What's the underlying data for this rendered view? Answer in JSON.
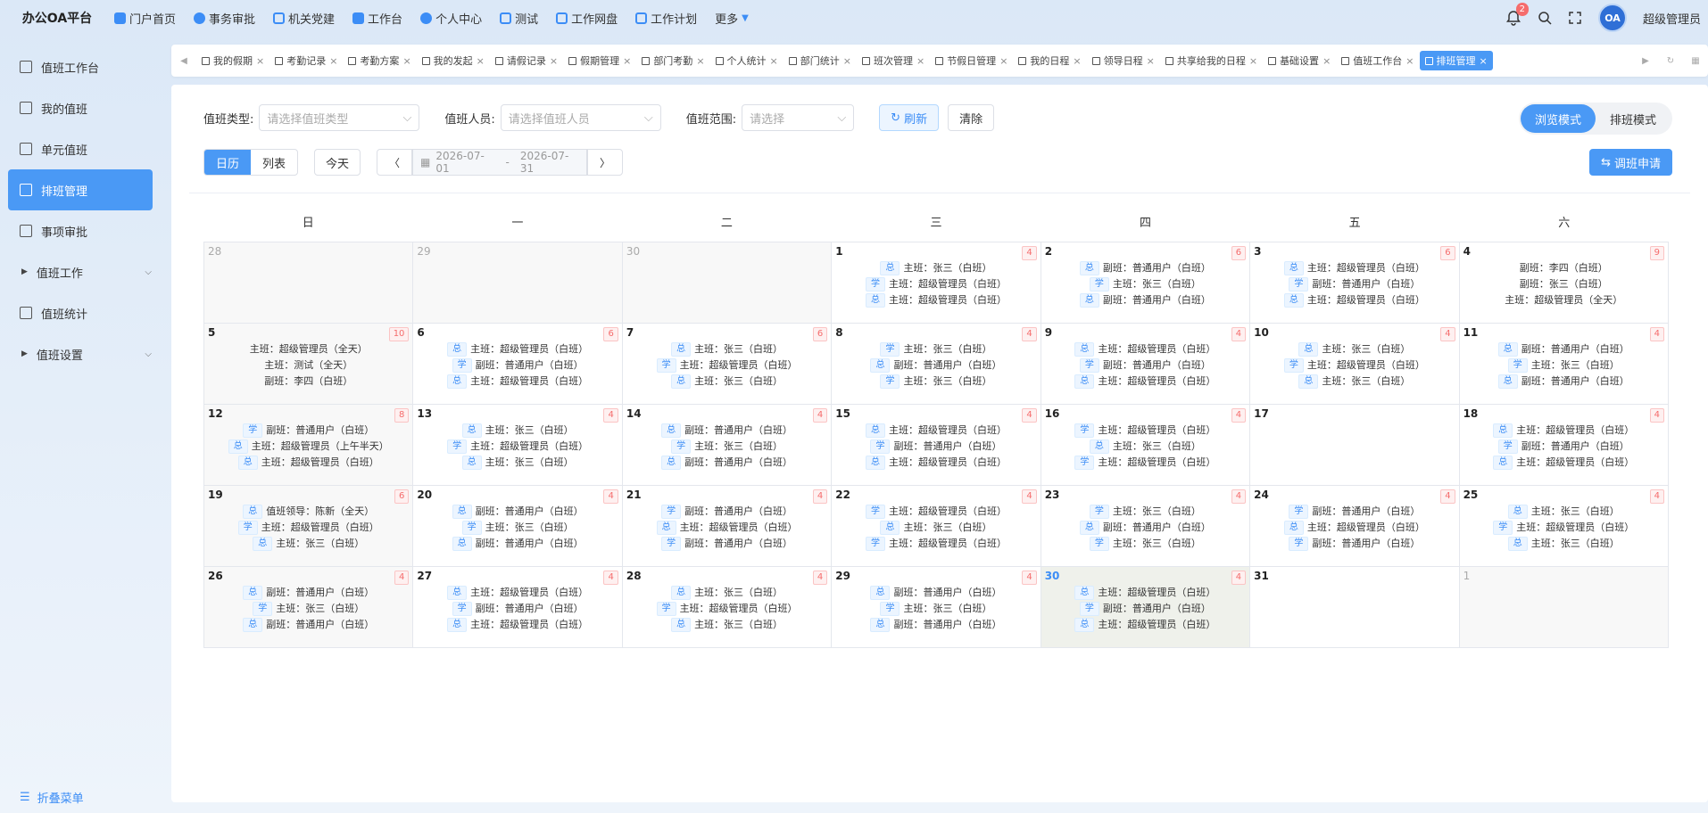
{
  "brand": "办公OA平台",
  "topnav": [
    "门户首页",
    "事务审批",
    "机关党建",
    "工作台",
    "个人中心",
    "测试",
    "工作网盘",
    "工作计划",
    "更多"
  ],
  "notif_count": "2",
  "avatar_text": "OA",
  "user_name": "超级管理员",
  "sidebar": [
    "值班工作台",
    "我的值班",
    "单元值班",
    "排班管理",
    "事项审批",
    "值班工作",
    "值班统计",
    "值班设置"
  ],
  "collapse_label": "折叠菜单",
  "tabs": [
    "我的假期",
    "考勤记录",
    "考勤方案",
    "我的发起",
    "请假记录",
    "假期管理",
    "部门考勤",
    "个人统计",
    "部门统计",
    "班次管理",
    "节假日管理",
    "我的日程",
    "领导日程",
    "共享给我的日程",
    "基础设置",
    "值班工作台",
    "排班管理"
  ],
  "filters": {
    "type_label": "值班类型:",
    "type_placeholder": "请选择值班类型",
    "person_label": "值班人员:",
    "person_placeholder": "请选择值班人员",
    "scope_label": "值班范围:",
    "scope_placeholder": "请选择",
    "refresh": "刷新",
    "clear": "清除"
  },
  "modes": [
    "浏览模式",
    "排班模式"
  ],
  "view_tabs": [
    "日历",
    "列表"
  ],
  "today_btn": "今天",
  "date_start": "2026-07-01",
  "date_sep": "-",
  "date_end": "2026-07-31",
  "apply_btn": "调班申请",
  "weekdays": [
    "日",
    "一",
    "二",
    "三",
    "四",
    "五",
    "六"
  ],
  "days": [
    {
      "d": "28",
      "other": true,
      "cnt": "",
      "ev": []
    },
    {
      "d": "29",
      "other": true,
      "cnt": "",
      "ev": []
    },
    {
      "d": "30",
      "other": true,
      "cnt": "",
      "ev": []
    },
    {
      "d": "1",
      "cnt": "4",
      "ev": [
        [
          "总",
          "主班：张三（白班）"
        ],
        [
          "学",
          "主班：超级管理员（白班）"
        ],
        [
          "总",
          "主班：超级管理员（白班）"
        ]
      ]
    },
    {
      "d": "2",
      "cnt": "6",
      "ev": [
        [
          "总",
          "副班：普通用户（白班）"
        ],
        [
          "学",
          "主班：张三（白班）"
        ],
        [
          "总",
          "副班：普通用户（白班）"
        ]
      ]
    },
    {
      "d": "3",
      "cnt": "6",
      "ev": [
        [
          "总",
          "主班：超级管理员（白班）"
        ],
        [
          "学",
          "副班：普通用户（白班）"
        ],
        [
          "总",
          "主班：超级管理员（白班）"
        ]
      ]
    },
    {
      "d": "4",
      "cnt": "9",
      "ev": [
        [
          "",
          "副班：李四（白班）"
        ],
        [
          "",
          "副班：张三（白班）"
        ],
        [
          "",
          "主班：超级管理员（全天）"
        ]
      ]
    },
    {
      "d": "5",
      "cnt": "10",
      "ev": [
        [
          "",
          "主班：超级管理员（全天）"
        ],
        [
          "",
          "主班：测试（全天）"
        ],
        [
          "",
          "副班：李四（白班）"
        ]
      ]
    },
    {
      "d": "6",
      "cnt": "6",
      "ev": [
        [
          "总",
          "主班：超级管理员（白班）"
        ],
        [
          "学",
          "副班：普通用户（白班）"
        ],
        [
          "总",
          "主班：超级管理员（白班）"
        ]
      ]
    },
    {
      "d": "7",
      "cnt": "6",
      "ev": [
        [
          "总",
          "主班：张三（白班）"
        ],
        [
          "学",
          "主班：超级管理员（白班）"
        ],
        [
          "总",
          "主班：张三（白班）"
        ]
      ]
    },
    {
      "d": "8",
      "cnt": "4",
      "ev": [
        [
          "学",
          "主班：张三（白班）"
        ],
        [
          "总",
          "副班：普通用户（白班）"
        ],
        [
          "学",
          "主班：张三（白班）"
        ]
      ]
    },
    {
      "d": "9",
      "cnt": "4",
      "ev": [
        [
          "总",
          "主班：超级管理员（白班）"
        ],
        [
          "学",
          "副班：普通用户（白班）"
        ],
        [
          "总",
          "主班：超级管理员（白班）"
        ]
      ]
    },
    {
      "d": "10",
      "cnt": "4",
      "ev": [
        [
          "总",
          "主班：张三（白班）"
        ],
        [
          "学",
          "主班：超级管理员（白班）"
        ],
        [
          "总",
          "主班：张三（白班）"
        ]
      ]
    },
    {
      "d": "11",
      "cnt": "4",
      "ev": [
        [
          "总",
          "副班：普通用户（白班）"
        ],
        [
          "学",
          "主班：张三（白班）"
        ],
        [
          "总",
          "副班：普通用户（白班）"
        ]
      ]
    },
    {
      "d": "12",
      "cnt": "8",
      "ev": [
        [
          "学",
          "副班：普通用户（白班）"
        ],
        [
          "总",
          "主班：超级管理员（上午半天）"
        ],
        [
          "总",
          "主班：超级管理员（白班）"
        ]
      ]
    },
    {
      "d": "13",
      "cnt": "4",
      "ev": [
        [
          "总",
          "主班：张三（白班）"
        ],
        [
          "学",
          "主班：超级管理员（白班）"
        ],
        [
          "总",
          "主班：张三（白班）"
        ]
      ]
    },
    {
      "d": "14",
      "cnt": "4",
      "ev": [
        [
          "总",
          "副班：普通用户（白班）"
        ],
        [
          "学",
          "主班：张三（白班）"
        ],
        [
          "总",
          "副班：普通用户（白班）"
        ]
      ]
    },
    {
      "d": "15",
      "cnt": "4",
      "ev": [
        [
          "总",
          "主班：超级管理员（白班）"
        ],
        [
          "学",
          "副班：普通用户（白班）"
        ],
        [
          "总",
          "主班：超级管理员（白班）"
        ]
      ]
    },
    {
      "d": "16",
      "cnt": "4",
      "ev": [
        [
          "学",
          "主班：超级管理员（白班）"
        ],
        [
          "总",
          "主班：张三（白班）"
        ],
        [
          "学",
          "主班：超级管理员（白班）"
        ]
      ]
    },
    {
      "d": "17",
      "cnt": "",
      "ev": []
    },
    {
      "d": "18",
      "cnt": "4",
      "ev": [
        [
          "总",
          "主班：超级管理员（白班）"
        ],
        [
          "学",
          "副班：普通用户（白班）"
        ],
        [
          "总",
          "主班：超级管理员（白班）"
        ]
      ]
    },
    {
      "d": "19",
      "cnt": "6",
      "ev": [
        [
          "总",
          "值班领导：陈新（全天）"
        ],
        [
          "学",
          "主班：超级管理员（白班）"
        ],
        [
          "总",
          "主班：张三（白班）"
        ]
      ]
    },
    {
      "d": "20",
      "cnt": "4",
      "ev": [
        [
          "总",
          "副班：普通用户（白班）"
        ],
        [
          "学",
          "主班：张三（白班）"
        ],
        [
          "总",
          "副班：普通用户（白班）"
        ]
      ]
    },
    {
      "d": "21",
      "cnt": "4",
      "ev": [
        [
          "学",
          "副班：普通用户（白班）"
        ],
        [
          "总",
          "主班：超级管理员（白班）"
        ],
        [
          "学",
          "副班：普通用户（白班）"
        ]
      ]
    },
    {
      "d": "22",
      "cnt": "4",
      "ev": [
        [
          "学",
          "主班：超级管理员（白班）"
        ],
        [
          "总",
          "主班：张三（白班）"
        ],
        [
          "学",
          "主班：超级管理员（白班）"
        ]
      ]
    },
    {
      "d": "23",
      "cnt": "4",
      "ev": [
        [
          "学",
          "主班：张三（白班）"
        ],
        [
          "总",
          "副班：普通用户（白班）"
        ],
        [
          "学",
          "主班：张三（白班）"
        ]
      ]
    },
    {
      "d": "24",
      "cnt": "4",
      "ev": [
        [
          "学",
          "副班：普通用户（白班）"
        ],
        [
          "总",
          "主班：超级管理员（白班）"
        ],
        [
          "学",
          "副班：普通用户（白班）"
        ]
      ]
    },
    {
      "d": "25",
      "cnt": "4",
      "ev": [
        [
          "总",
          "主班：张三（白班）"
        ],
        [
          "学",
          "主班：超级管理员（白班）"
        ],
        [
          "总",
          "主班：张三（白班）"
        ]
      ]
    },
    {
      "d": "26",
      "cnt": "4",
      "ev": [
        [
          "总",
          "副班：普通用户（白班）"
        ],
        [
          "学",
          "主班：张三（白班）"
        ],
        [
          "总",
          "副班：普通用户（白班）"
        ]
      ]
    },
    {
      "d": "27",
      "cnt": "4",
      "ev": [
        [
          "总",
          "主班：超级管理员（白班）"
        ],
        [
          "学",
          "副班：普通用户（白班）"
        ],
        [
          "总",
          "主班：超级管理员（白班）"
        ]
      ]
    },
    {
      "d": "28",
      "cnt": "4",
      "ev": [
        [
          "总",
          "主班：张三（白班）"
        ],
        [
          "学",
          "主班：超级管理员（白班）"
        ],
        [
          "总",
          "主班：张三（白班）"
        ]
      ]
    },
    {
      "d": "29",
      "cnt": "4",
      "ev": [
        [
          "总",
          "副班：普通用户（白班）"
        ],
        [
          "学",
          "主班：张三（白班）"
        ],
        [
          "总",
          "副班：普通用户（白班）"
        ]
      ]
    },
    {
      "d": "30",
      "today": true,
      "cnt": "4",
      "ev": [
        [
          "总",
          "主班：超级管理员（白班）"
        ],
        [
          "学",
          "副班：普通用户（白班）"
        ],
        [
          "总",
          "主班：超级管理员（白班）"
        ]
      ]
    },
    {
      "d": "31",
      "cnt": "",
      "ev": []
    },
    {
      "d": "1",
      "other": true,
      "cnt": "",
      "ev": []
    }
  ]
}
